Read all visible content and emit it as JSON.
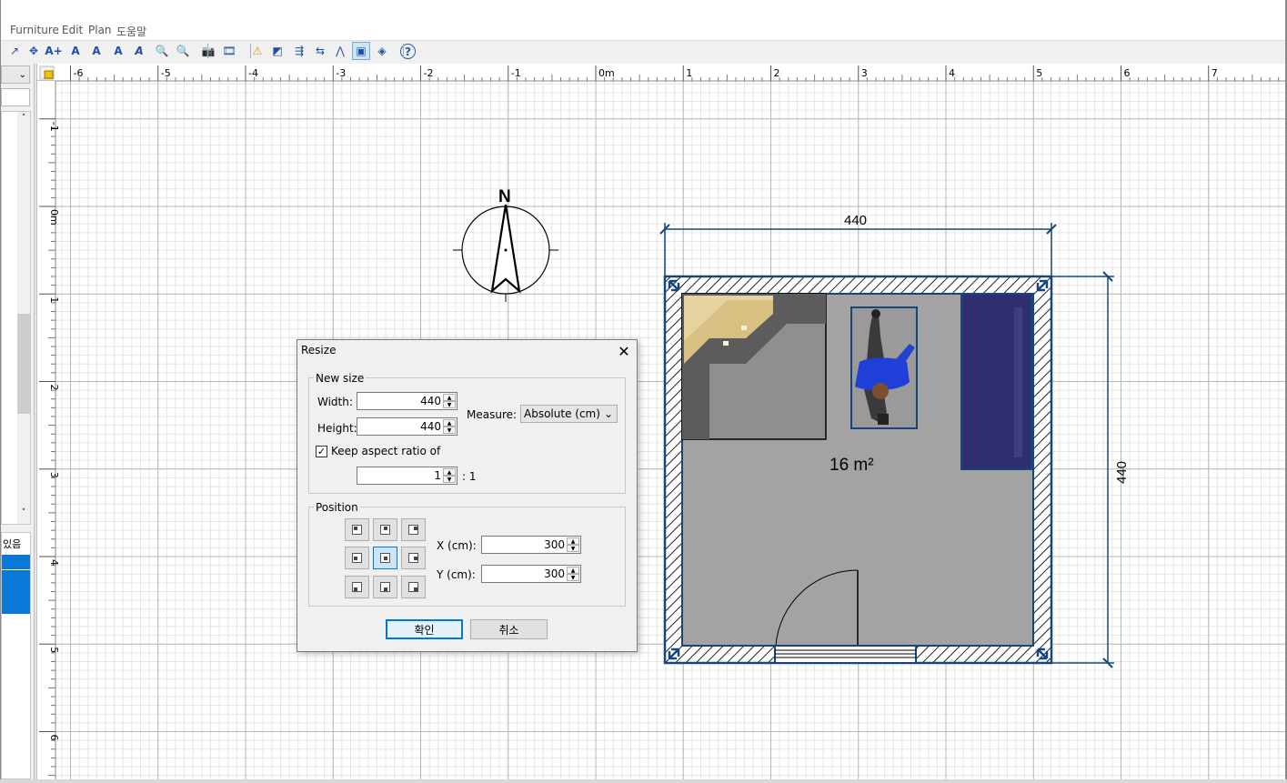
{
  "menu": {
    "items": [
      {
        "label": "Furniture"
      },
      {
        "label": "Edit"
      },
      {
        "label": "Plan"
      },
      {
        "label": "도움말"
      }
    ]
  },
  "toolbar": {
    "buttons": [
      {
        "icon": "add-level-icon",
        "glyph": "↗"
      },
      {
        "icon": "rotate-icon",
        "glyph": "✥"
      },
      {
        "icon": "add-text-icon",
        "glyph": "A+"
      },
      {
        "icon": "text-style-icon",
        "glyph": "A"
      },
      {
        "icon": "text-style-icon",
        "glyph": "A"
      },
      {
        "icon": "text-bold-icon",
        "glyph": "A"
      },
      {
        "icon": "text-italic-icon",
        "glyph": "A"
      },
      {
        "icon": "zoom-in-icon",
        "glyph": "🔍"
      },
      {
        "icon": "zoom-out-icon",
        "glyph": "🔍"
      },
      {
        "icon": "camera-icon",
        "glyph": "📷"
      },
      {
        "icon": "video-icon",
        "glyph": "🎞"
      },
      {
        "icon": "warning-icon",
        "glyph": "⚠"
      },
      {
        "icon": "flip-icon",
        "glyph": "◩"
      },
      {
        "icon": "import-icon",
        "glyph": "⇶"
      },
      {
        "icon": "align-icon",
        "glyph": "⇆"
      },
      {
        "icon": "mirror-icon",
        "glyph": "⋀"
      },
      {
        "icon": "resize-icon",
        "glyph": "▣"
      },
      {
        "icon": "paint-icon",
        "glyph": "◈"
      },
      {
        "icon": "help-icon",
        "glyph": "?"
      }
    ]
  },
  "left_panel": {
    "table_header": "있음"
  },
  "ruler": {
    "top_labels": [
      "-6",
      "-5",
      "-4",
      "-3",
      "-2",
      "-1",
      "0m",
      "1",
      "2",
      "3",
      "4",
      "5",
      "6",
      "7"
    ],
    "left_labels": [
      "-1",
      "0m",
      "1",
      "2",
      "3",
      "4",
      "5",
      "6"
    ]
  },
  "plan": {
    "compass_label": "N",
    "dimension_width": "440",
    "dimension_height": "440",
    "room_area": "16 m²"
  },
  "dialog": {
    "title": "Resize",
    "close_glyph": "✕",
    "new_size_group": "New size",
    "width_label": "Width:",
    "width_value": "440",
    "height_label": "Height:",
    "height_value": "440",
    "measure_label": "Measure:",
    "measure_value": "Absolute (cm)",
    "keep_aspect_label": "Keep aspect ratio of",
    "keep_aspect_checked": true,
    "ratio_value": "1",
    "ratio_suffix": ": 1",
    "position_group": "Position",
    "x_label": "X (cm):",
    "x_value": "300",
    "y_label": "Y (cm):",
    "y_value": "300",
    "ok_label": "확인",
    "cancel_label": "취소"
  },
  "colors": {
    "accent": "#0078d7",
    "grid_minor": "#e2e2e2",
    "grid_major": "#b4b4b4",
    "room_floor": "#a3a3a3",
    "wall_outline": "#17467a",
    "selection_row": "#0a78d7",
    "wardrobe": "#2e2e70"
  }
}
